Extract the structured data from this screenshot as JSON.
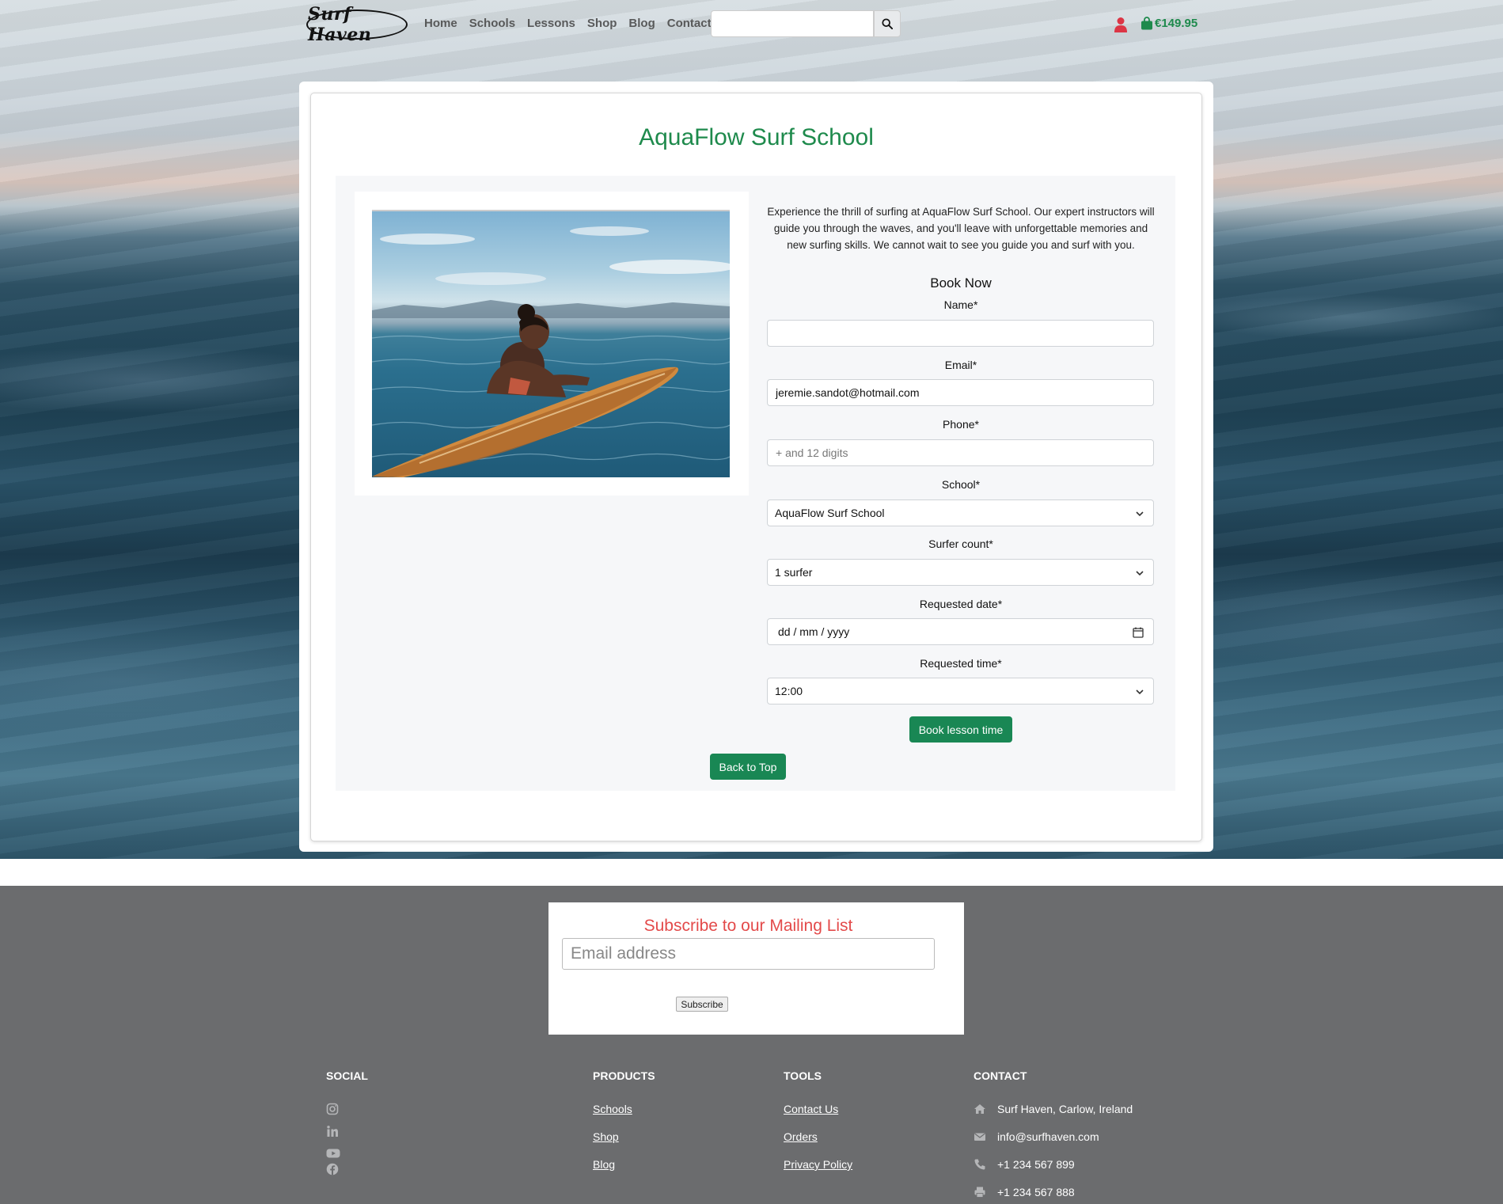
{
  "nav": {
    "logo": "Surf Haven",
    "links": [
      "Home",
      "Schools",
      "Lessons",
      "Shop",
      "Blog",
      "Contact"
    ],
    "search_value": "",
    "cart_total": "€149.95"
  },
  "page": {
    "title": "AquaFlow Surf School",
    "description": "Experience the thrill of surfing at AquaFlow Surf School. Our expert instructors will guide you through the waves, and you'll leave with unforgettable memories and new surfing skills. We cannot wait to see you guide you and surf with you."
  },
  "form": {
    "heading": "Book Now",
    "name_label": "Name*",
    "name_value": "",
    "email_label": "Email*",
    "email_value": "jeremie.sandot@hotmail.com",
    "phone_label": "Phone*",
    "phone_placeholder": "+ and 12 digits",
    "school_label": "School*",
    "school_value": "AquaFlow Surf School",
    "count_label": "Surfer count*",
    "count_value": "1 surfer",
    "date_label": "Requested date*",
    "date_placeholder": "dd / mm / yyyy",
    "time_label": "Requested time*",
    "time_value": "12:00",
    "submit_label": "Book lesson time"
  },
  "back_to_top": "Back to Top",
  "subscribe": {
    "title": "Subscribe to our Mailing List",
    "placeholder": "Email address",
    "button": "Subscribe"
  },
  "footer": {
    "social_heading": "SOCIAL",
    "products_heading": "PRODUCTS",
    "products": [
      "Schools",
      "Shop",
      "Blog"
    ],
    "tools_heading": "TOOLS",
    "tools": [
      "Contact Us",
      "Orders",
      "Privacy Policy"
    ],
    "contact_heading": "CONTACT",
    "address": "Surf Haven, Carlow, Ireland",
    "email": "info@surfhaven.com",
    "phone": "+1 234 567 899",
    "fax": "+1 234 567 888"
  },
  "colors": {
    "brand_green": "#198754",
    "title_green": "#1e8a4c",
    "subscribe_red": "#e34a4a",
    "user_icon_red": "#dc3545",
    "footer_bg": "#6b6c6e"
  },
  "icons": [
    "search-icon",
    "user-icon",
    "shopping-bag-icon",
    "chevron-down-icon",
    "calendar-icon",
    "instagram-icon",
    "linkedin-icon",
    "youtube-icon",
    "facebook-icon",
    "home-icon",
    "envelope-icon",
    "phone-icon",
    "print-icon"
  ]
}
